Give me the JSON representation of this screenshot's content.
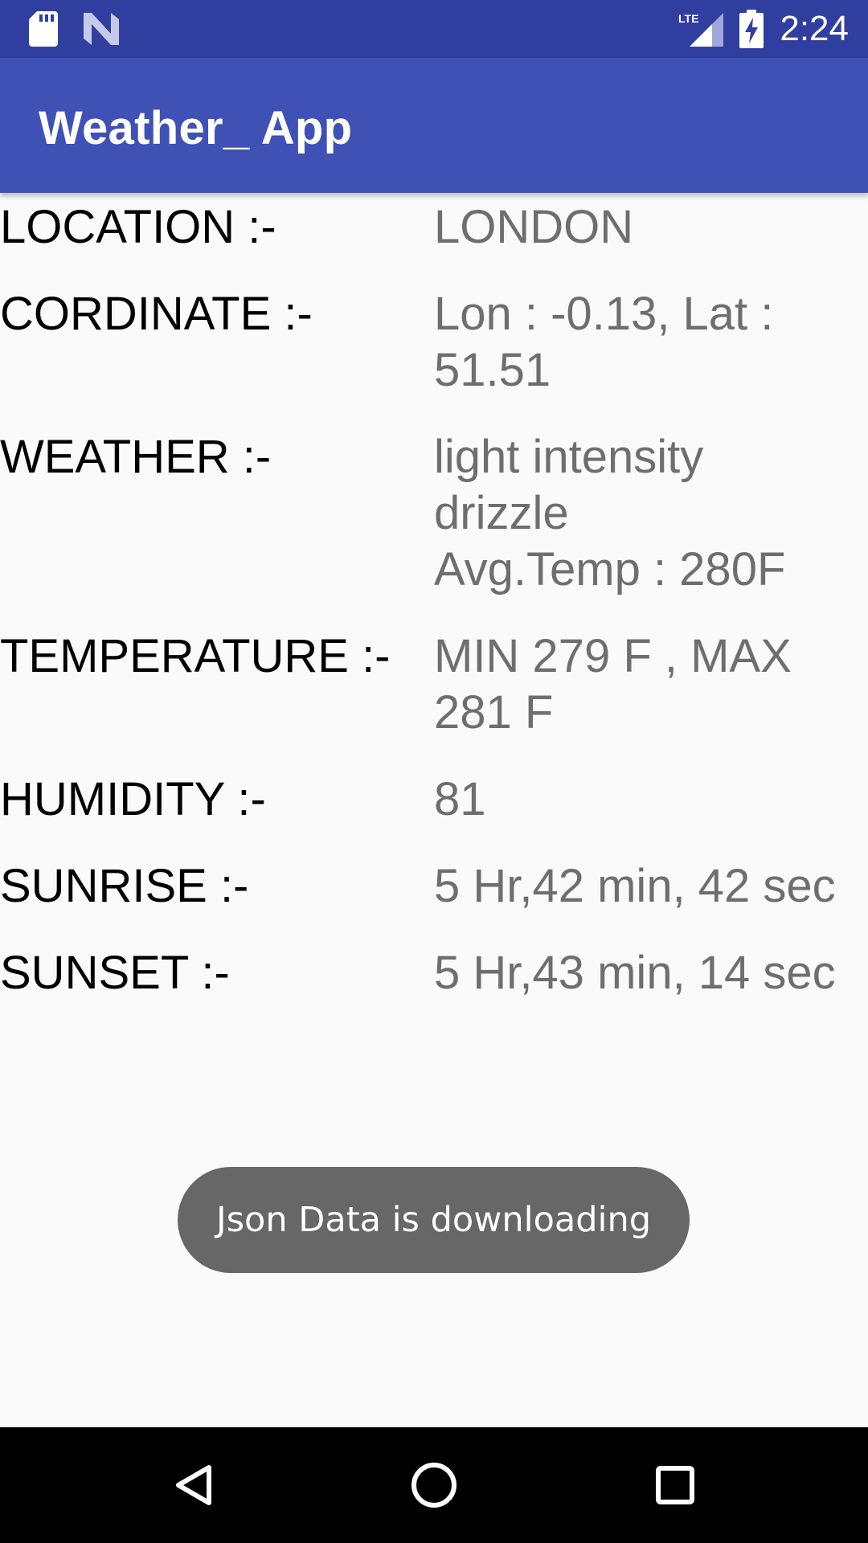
{
  "status_bar": {
    "time": "2:24",
    "network_label": "LTE",
    "icons": [
      "sd-card-icon",
      "n-logo-icon",
      "lte-signal-icon",
      "battery-charging-icon"
    ]
  },
  "app_bar": {
    "title": "Weather_ App"
  },
  "weather": {
    "location": {
      "label": "LOCATION :-",
      "value": [
        "LONDON"
      ]
    },
    "coordinate": {
      "label": "CORDINATE :-",
      "value": [
        "Lon : -0.13, Lat :",
        "51.51"
      ]
    },
    "weather": {
      "label": "WEATHER :-",
      "value": [
        "light intensity",
        "drizzle",
        "Avg.Temp : 280F"
      ]
    },
    "temperature": {
      "label": "TEMPERATURE :-",
      "value": [
        "MIN 279 F , MAX",
        "281 F"
      ]
    },
    "humidity": {
      "label": "HUMIDITY :-",
      "value": [
        "81"
      ]
    },
    "sunrise": {
      "label": "SUNRISE :-",
      "value": [
        "5 Hr,42 min, 42 sec"
      ]
    },
    "sunset": {
      "label": "SUNSET :-",
      "value": [
        "5 Hr,43 min, 14 sec"
      ]
    }
  },
  "toast": {
    "message": "Json Data is downloading"
  },
  "nav_bar": {
    "icons": [
      "back-icon",
      "home-icon",
      "recents-icon"
    ]
  },
  "colors": {
    "status_bar": "#303f9f",
    "app_bar": "#3f51b5",
    "background": "#fafafa",
    "value_text": "#6e6e6e",
    "toast_bg": "#676767"
  }
}
